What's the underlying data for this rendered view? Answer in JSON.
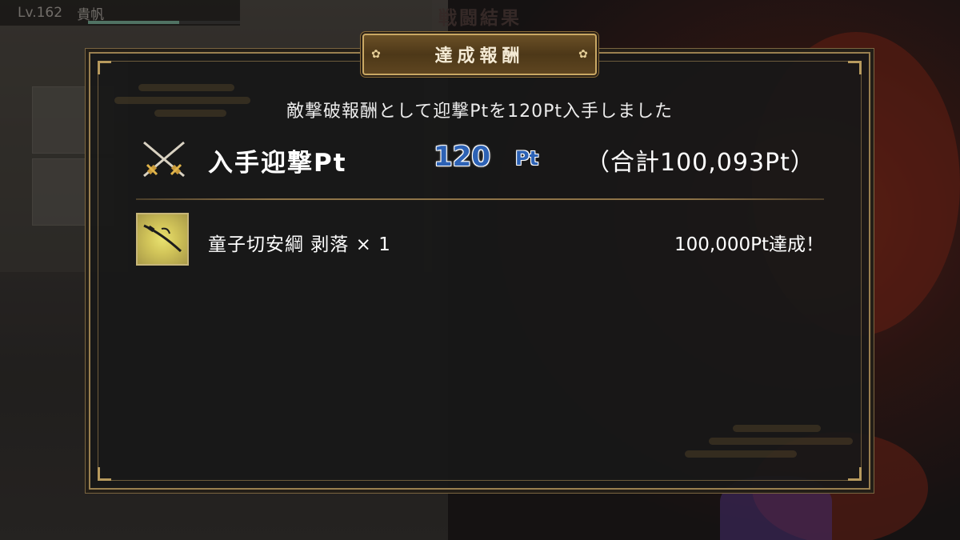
{
  "background": {
    "level_label": "Lv.162",
    "player_name": "貴帆",
    "level_progress_fraction": 0.6,
    "battle_result_title": "戦闘結果",
    "accent_colors": {
      "red": "#8a2a1a",
      "purple": "#5a3a8a"
    }
  },
  "dialog": {
    "title": "達成報酬",
    "message": "敵撃破報酬として迎撃Ptを120Pt入手しました",
    "points": {
      "icon": "crossed-swords-icon",
      "label": "入手迎撃Pt",
      "value": "120",
      "unit": "Pt",
      "total": "（合計100,093Pt）"
    },
    "reward": {
      "icon": "katana-item-icon",
      "name": "童子切安綱 剥落 × 1",
      "note": "100,000Pt達成！"
    }
  },
  "colors": {
    "frame_gold": "#9a8050",
    "header_plate": "#5e4520",
    "points_blue": "#2d62b5",
    "dialog_bg": "#181818"
  }
}
